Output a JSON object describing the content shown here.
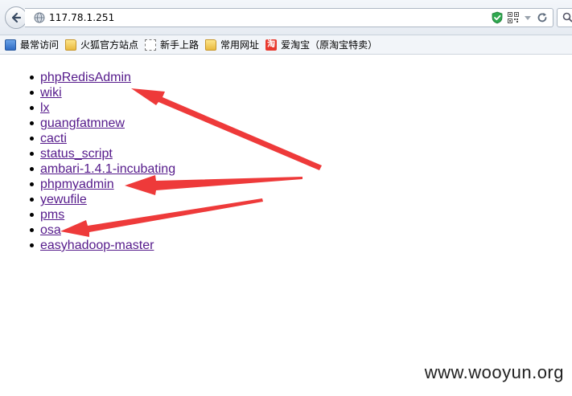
{
  "browser": {
    "url": "117.78.1.251",
    "bookmarks": [
      {
        "label": "最常访问",
        "icon": "most-visited-icon"
      },
      {
        "label": "火狐官方站点",
        "icon": "folder-icon"
      },
      {
        "label": "新手上路",
        "icon": "dashed-page-icon"
      },
      {
        "label": "常用网址",
        "icon": "folder-icon"
      },
      {
        "label": "爱淘宝（原淘宝特卖）",
        "icon": "taobao-icon"
      }
    ],
    "taobao_glyph": "淘"
  },
  "page": {
    "links": [
      "phpRedisAdmin",
      "wiki",
      "lx",
      "guangfatmnew",
      "cacti",
      "status_script",
      "ambari-1.4.1-incubating",
      "phpmyadmin",
      "yewufile",
      "pms",
      "osa",
      "easyhadoop-master"
    ],
    "link_color": "#551a8b",
    "arrow_color": "#ee3a3a"
  },
  "watermark": "www.wooyun.org"
}
